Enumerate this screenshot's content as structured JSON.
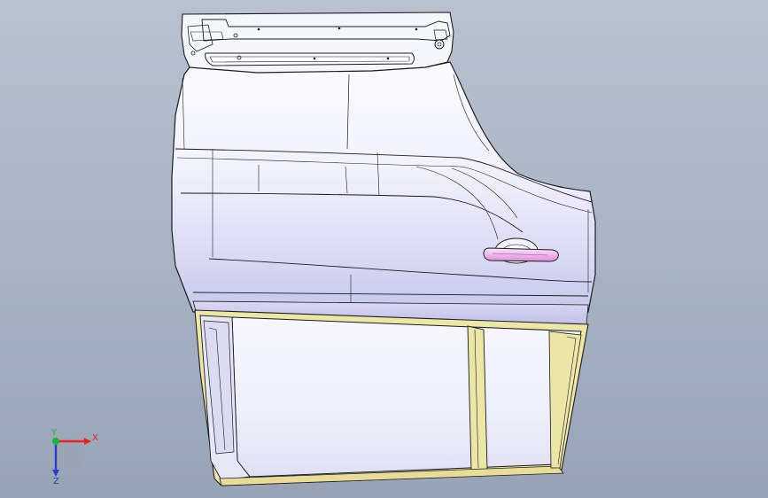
{
  "viewport": {
    "background_top": "#b9c2cf",
    "background_bottom": "#98a3b4"
  },
  "model": {
    "part": "car-door-3d-model",
    "body_color": "#f0f0fb",
    "shade_color": "#c9c9ec",
    "frame_color": "#ece6a8",
    "edge_color": "#1c1c24",
    "handle_color": "#efb8ec"
  },
  "triad": {
    "x_label": "X",
    "y_label": "Y",
    "z_label": "Z",
    "x_color": "#e0262a",
    "y_color": "#19b33a",
    "z_color": "#2a3fc6"
  }
}
